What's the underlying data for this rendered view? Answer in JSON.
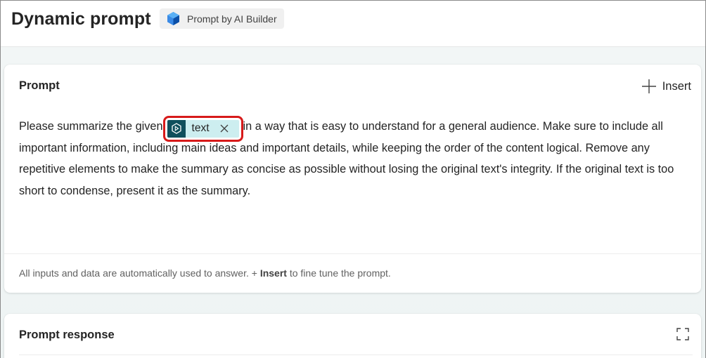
{
  "header": {
    "title": "Dynamic prompt",
    "badge_label": "Prompt by AI Builder",
    "badge_icon": "ai-builder-icon"
  },
  "prompt_card": {
    "title": "Prompt",
    "insert_label": "Insert",
    "insert_icon": "plus-icon",
    "text_before": "Please summarize the given",
    "token": {
      "label": "text",
      "icon": "input-token-icon",
      "remove_icon": "close-icon",
      "highlight_color": "#d71a1a"
    },
    "text_after": "in a way that is easy to understand for a general audience. Make sure to include all important information, including main ideas and important details, while keeping the order of the content logical. Remove any repetitive elements to make the summary as concise as possible without losing the original text's integrity. If the original text is too short to condense, present it as the summary.",
    "footer_before": "All inputs and data are automatically used to answer. + ",
    "footer_bold": "Insert",
    "footer_after": " to fine tune the prompt."
  },
  "response_card": {
    "title": "Prompt response",
    "expand_icon": "expand-icon"
  },
  "colors": {
    "token_background": "#cdeef0",
    "token_icon_background": "#0f4f5c",
    "canvas_background": "#f2f6f6"
  }
}
